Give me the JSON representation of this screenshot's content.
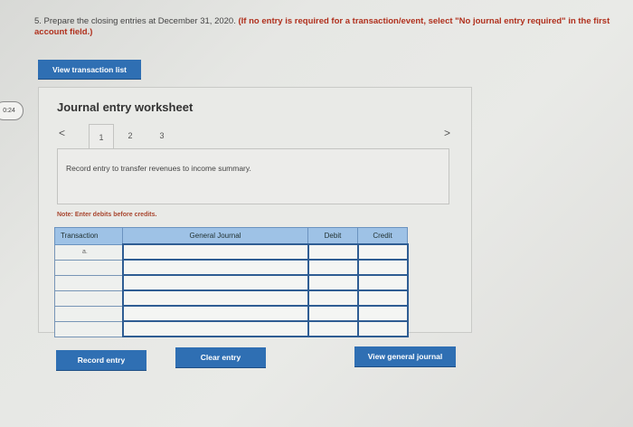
{
  "question": {
    "text": "5. Prepare the closing entries at December 31, 2020.",
    "instruction": "(If no entry is required for a transaction/event, select \"No journal entry required\" in the first account field.)"
  },
  "badge": {
    "text": "0:24"
  },
  "buttons": {
    "view_transaction_list": "View transaction list",
    "record_entry": "Record entry",
    "clear_entry": "Clear entry",
    "view_general_journal": "View general journal"
  },
  "worksheet": {
    "title": "Journal entry worksheet",
    "nav": {
      "prev": "<",
      "next": ">"
    },
    "tabs": [
      "1",
      "2",
      "3"
    ],
    "active_tab": 0,
    "entry_description": "Record entry to transfer revenues to income summary.",
    "note": "Note: Enter debits before credits."
  },
  "journal_table": {
    "headers": {
      "transaction": "Transaction",
      "general_journal": "General Journal",
      "debit": "Debit",
      "credit": "Credit"
    },
    "rows": [
      {
        "transaction": "a.",
        "account": "",
        "debit": "",
        "credit": ""
      },
      {
        "transaction": "",
        "account": "",
        "debit": "",
        "credit": ""
      },
      {
        "transaction": "",
        "account": "",
        "debit": "",
        "credit": ""
      },
      {
        "transaction": "",
        "account": "",
        "debit": "",
        "credit": ""
      },
      {
        "transaction": "",
        "account": "",
        "debit": "",
        "credit": ""
      },
      {
        "transaction": "",
        "account": "",
        "debit": "",
        "credit": ""
      }
    ]
  }
}
